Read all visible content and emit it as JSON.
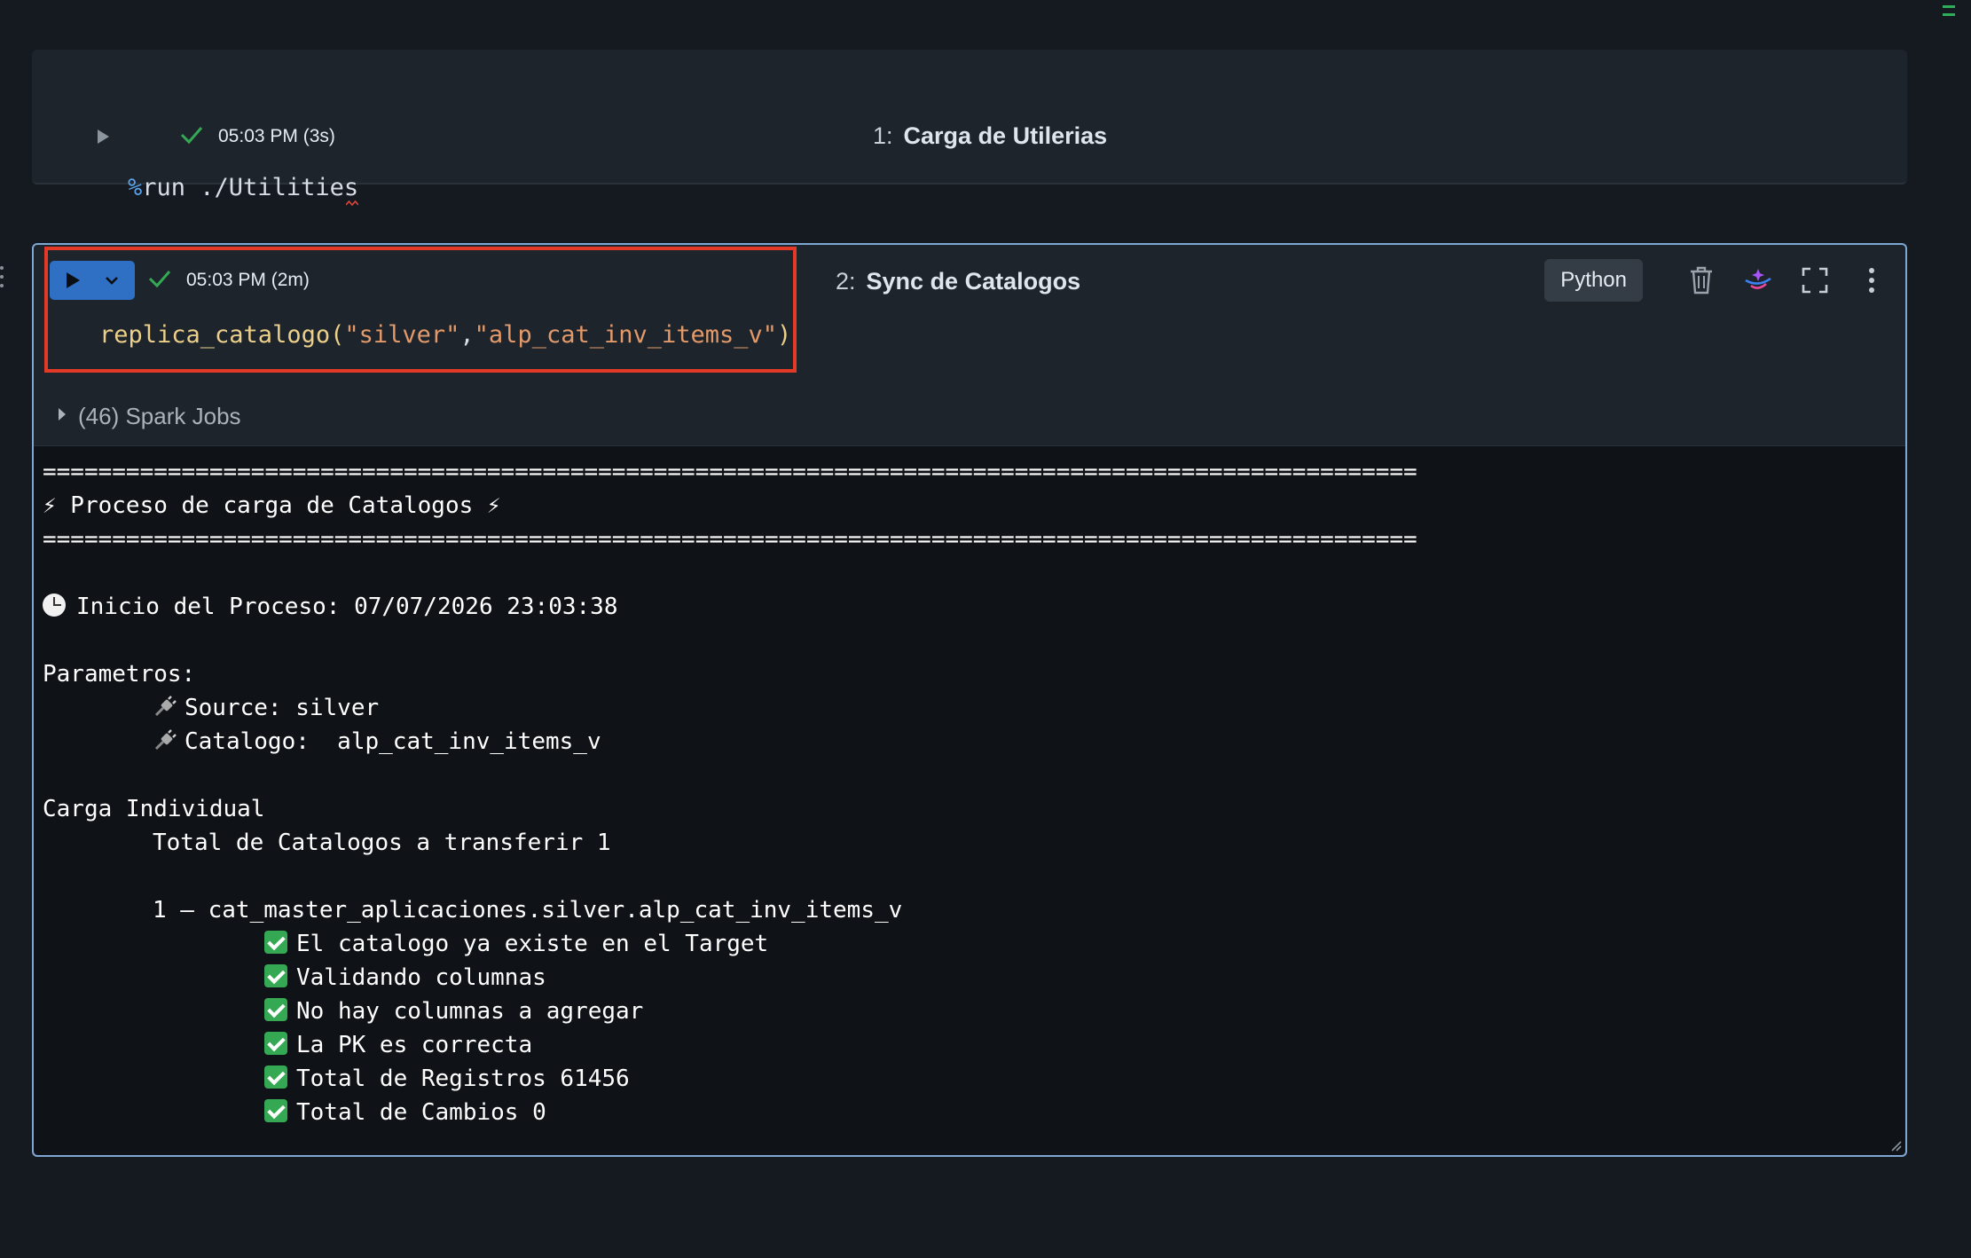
{
  "cells": [
    {
      "number": "1:",
      "title": "Carga de Utilerias",
      "timestamp": "05:03 PM (3s)",
      "code_magic": "%",
      "code_rest": "run ./Utilities"
    },
    {
      "number": "2:",
      "title": "Sync de Catalogos",
      "timestamp": "05:03 PM (2m)",
      "code_fn": "replica_catalogo",
      "code_open": "(",
      "code_arg1": "\"silver\"",
      "code_comma": ",",
      "code_arg2": "\"alp_cat_inv_items_v\"",
      "code_close": ")",
      "language": "Python",
      "spark_jobs": "(46) Spark Jobs"
    }
  ],
  "colors": {
    "run_button": "#2f6fc4",
    "highlight_border": "#e23a27",
    "selected_cell_border": "#7fa7d4",
    "success_check": "#34a853"
  },
  "icons": [
    "run-icon",
    "check-icon",
    "chevron-down-icon",
    "trash-icon",
    "assistant-icon",
    "expand-icon",
    "more-vertical-icon",
    "caret-right-icon"
  ],
  "output": {
    "sep1": "===================================================================================================",
    "header": "⚡ Proceso de carga de Catalogos ⚡",
    "sep2": "===================================================================================================",
    "start": "Inicio del Proceso: 07/07/2026 23:03:38",
    "params_label": "Parametros:",
    "source": "Source: silver",
    "catalog": "Catalogo:  alp_cat_inv_items_v",
    "load_type": "Carga Individual",
    "total": "Total de Catalogos a transferir 1",
    "item": "1 – cat_master_aplicaciones.silver.alp_cat_inv_items_v",
    "checks": [
      "El catalogo ya existe en el Target",
      "Validando columnas",
      "No hay columnas a agregar",
      "La PK es correcta",
      "Total de Registros 61456",
      "Total de Cambios 0"
    ]
  }
}
